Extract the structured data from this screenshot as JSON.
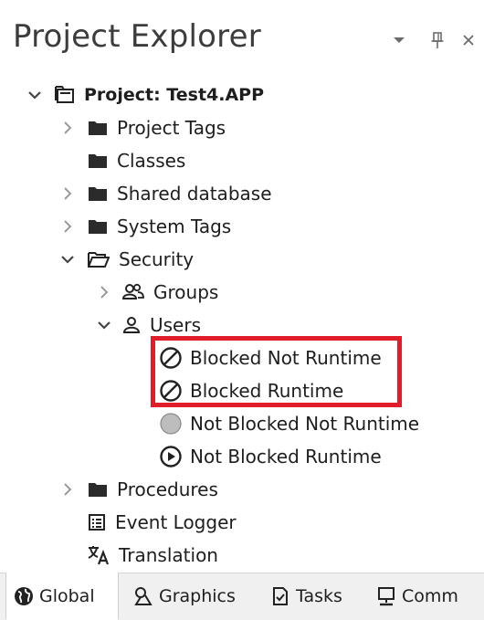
{
  "panel": {
    "title": "Project Explorer",
    "controls": {
      "dropdown_icon": "chevron-down-icon",
      "pin_icon": "pin-icon",
      "close_icon": "close-icon"
    }
  },
  "tree": {
    "project": "Project: Test4.APP",
    "project_tags": "Project Tags",
    "classes": "Classes",
    "shared_database": "Shared database",
    "system_tags": "System Tags",
    "security": "Security",
    "groups": "Groups",
    "users": "Users",
    "blocked_not_runtime": "Blocked Not Runtime",
    "blocked_runtime": "Blocked Runtime",
    "not_blocked_not_runtime": "Not Blocked Not Runtime",
    "not_blocked_runtime": "Not Blocked Runtime",
    "procedures": "Procedures",
    "event_logger": "Event Logger",
    "translation": "Translation"
  },
  "tabs": [
    {
      "label": "Global",
      "icon": "globe-icon",
      "active": true
    },
    {
      "label": "Graphics",
      "icon": "graphics-icon",
      "active": false
    },
    {
      "label": "Tasks",
      "icon": "tasks-icon",
      "active": false
    },
    {
      "label": "Comm",
      "icon": "monitor-icon",
      "active": false
    }
  ],
  "colors": {
    "highlight_border": "#e11d2a",
    "folder_fill": "#2b2b2b",
    "tab_bar": "#f0f0f0"
  }
}
